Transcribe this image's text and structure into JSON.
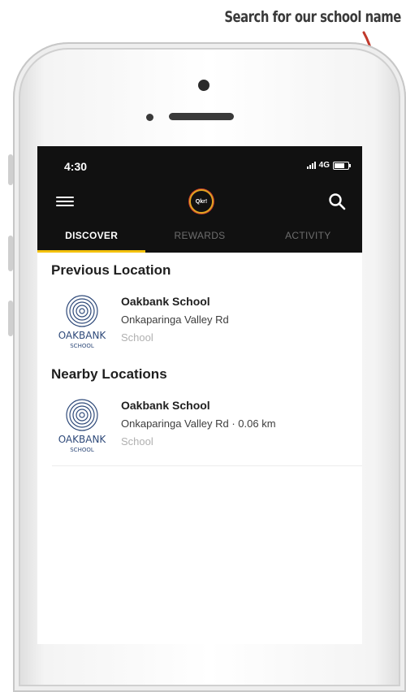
{
  "annotation": {
    "text": "Search for our school name"
  },
  "status_bar": {
    "time": "4:30",
    "network": "4G"
  },
  "app_bar": {
    "logo_text": "Qkr!"
  },
  "tabs": [
    {
      "label": "DISCOVER",
      "active": true
    },
    {
      "label": "REWARDS",
      "active": false
    },
    {
      "label": "ACTIVITY",
      "active": false
    }
  ],
  "previous": {
    "title": "Previous Location",
    "item": {
      "name": "Oakbank School",
      "address": "Onkaparinga Valley Rd",
      "type": "School",
      "logo_word": "OAKBANK",
      "logo_sub": "SCHOOL"
    }
  },
  "nearby": {
    "title": "Nearby Locations",
    "item": {
      "name": "Oakbank School",
      "address": "Onkaparinga Valley Rd · 0.06 km",
      "type": "School",
      "logo_word": "OAKBANK",
      "logo_sub": "SCHOOL"
    }
  },
  "colors": {
    "accent": "#f4c20d",
    "header_bg": "#111111",
    "arrow": "#c0392b",
    "logo_blue": "#2f4a7a"
  },
  "icons": [
    "menu-icon",
    "search-icon",
    "signal-icon",
    "battery-icon",
    "school-logo-icon",
    "arrow-icon"
  ]
}
